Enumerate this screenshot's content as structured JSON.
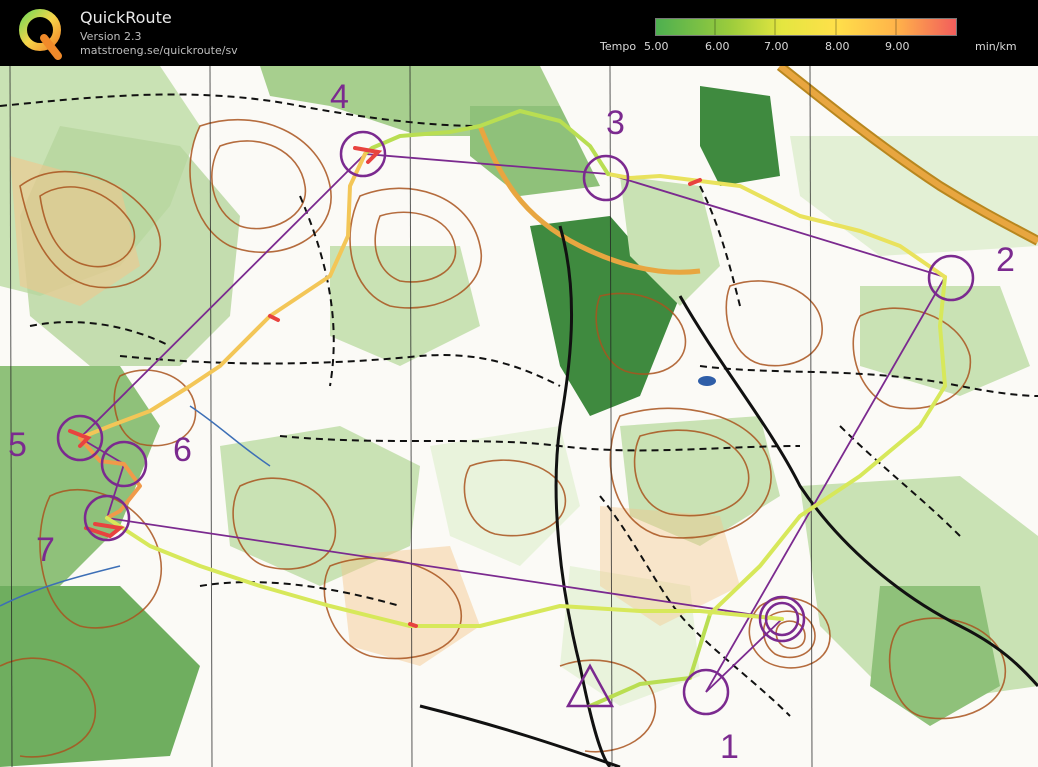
{
  "header": {
    "title": "QuickRoute",
    "version": "Version 2.3",
    "url": "matstroeng.se/quickroute/sv",
    "logo_letter": "Q"
  },
  "legend": {
    "tempo_label": "Tempo",
    "unit": "min/km",
    "ticks": [
      "5.00",
      "6.00",
      "7.00",
      "8.00",
      "9.00"
    ],
    "colors": [
      "#4caf50",
      "#8bc34a",
      "#cddc39",
      "#ffeb3b",
      "#ffc107",
      "#ff9800",
      "#f44336"
    ]
  },
  "map": {
    "controls": [
      {
        "label": "1"
      },
      {
        "label": "2"
      },
      {
        "label": "3"
      },
      {
        "label": "4"
      },
      {
        "label": "5"
      },
      {
        "label": "6"
      },
      {
        "label": "7"
      }
    ],
    "colors": {
      "paper": "#fbfaf6",
      "forest_light": "#c9e2b4",
      "forest_mid": "#8fc17a",
      "forest_dark": "#3f8a3f",
      "contour": "#a9541e",
      "course": "#7b2a8f",
      "path": "#111111",
      "road": "#e8a640"
    }
  }
}
